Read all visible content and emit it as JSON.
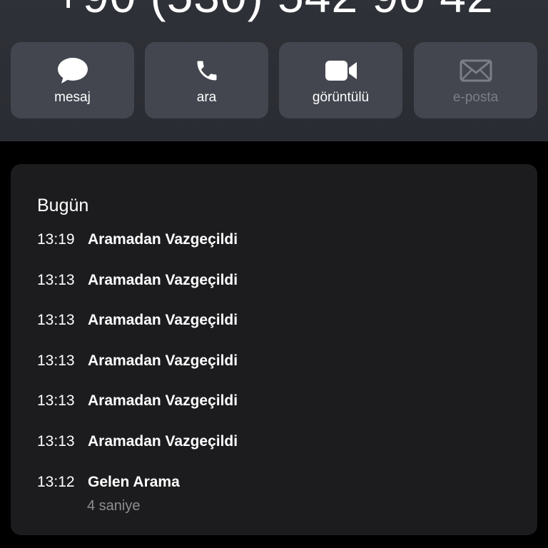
{
  "contact": {
    "phone_number": "+90 (530) 542 90 42"
  },
  "actions": [
    {
      "label": "mesaj",
      "icon": "message-bubble-icon",
      "enabled": true
    },
    {
      "label": "ara",
      "icon": "phone-icon",
      "enabled": true
    },
    {
      "label": "görüntülü",
      "icon": "video-camera-icon",
      "enabled": true
    },
    {
      "label": "e-posta",
      "icon": "mail-envelope-icon",
      "enabled": false
    }
  ],
  "history": {
    "title": "Bugün",
    "calls": [
      {
        "time": "13:19",
        "type": "Aramadan Vazgeçildi"
      },
      {
        "time": "13:13",
        "type": "Aramadan Vazgeçildi"
      },
      {
        "time": "13:13",
        "type": "Aramadan Vazgeçildi"
      },
      {
        "time": "13:13",
        "type": "Aramadan Vazgeçildi"
      },
      {
        "time": "13:13",
        "type": "Aramadan Vazgeçildi"
      },
      {
        "time": "13:13",
        "type": "Aramadan Vazgeçildi"
      },
      {
        "time": "13:12",
        "type": "Gelen Arama",
        "duration": "4 saniye"
      }
    ]
  },
  "colors": {
    "button_background": "#43464f",
    "card_background": "#1c1c1e",
    "secondary_text": "#8d8e93",
    "disabled_text": "#7b7e86"
  }
}
